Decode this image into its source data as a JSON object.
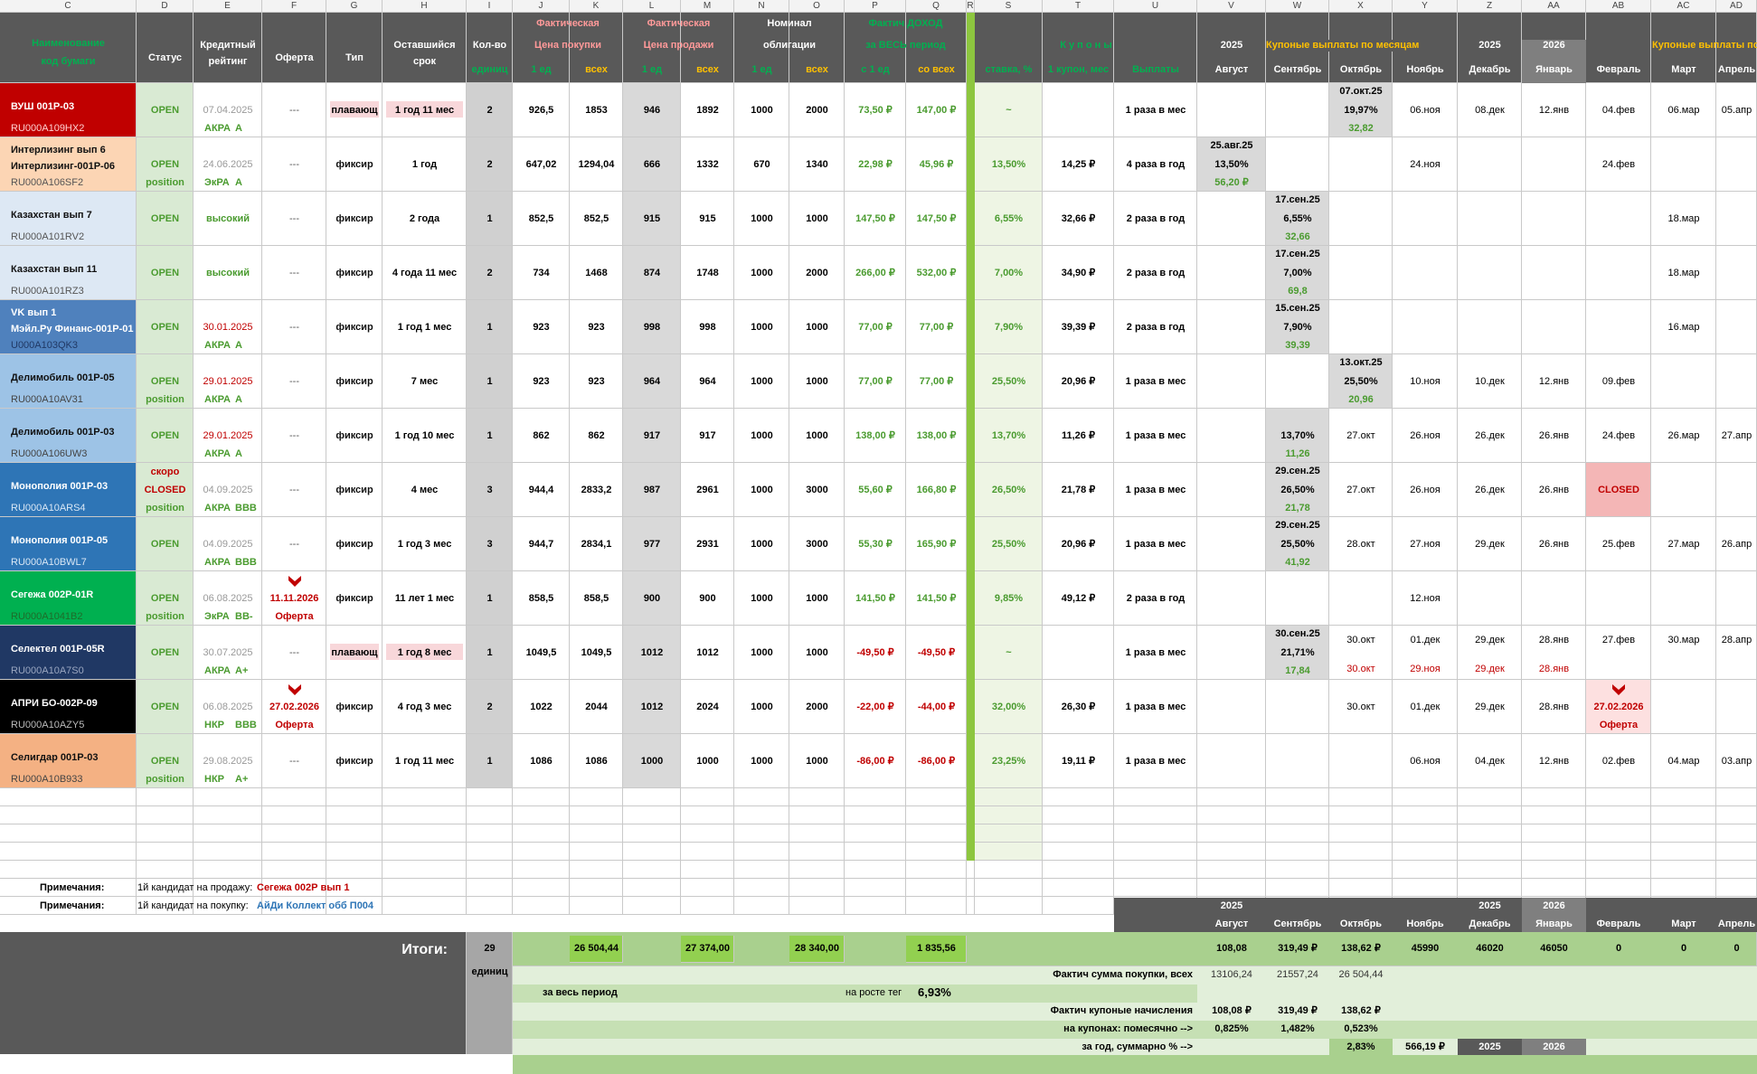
{
  "column_letters": [
    "C",
    "D",
    "E",
    "F",
    "G",
    "H",
    "I",
    "J",
    "K",
    "L",
    "M",
    "N",
    "O",
    "P",
    "Q",
    "R",
    "S",
    "T",
    "U",
    "V",
    "W",
    "X",
    "Y",
    "Z",
    "AA",
    "AB",
    "AC",
    "AD"
  ],
  "header": {
    "name_1": "Наименование",
    "name_2": "код бумаги",
    "status": "Статус",
    "rating_1": "Кредитный",
    "rating_2": "рейтинг",
    "offer": "Оферта",
    "type": "Тип",
    "term_1": "Оставшийся",
    "term_2": "срок",
    "qty_1": "Кол-во",
    "qty_2": "единиц",
    "buy_1": "Фактическая",
    "buy_2": "Цена  покупки",
    "sell_1": "Фактическая",
    "sell_2": "Цена  продажи",
    "nom_1": "Номинал",
    "nom_2": "облигации",
    "inc_1": "Фактич ДОХОД",
    "inc_2": "за ВЕСЬ период",
    "coupons": "К у п о н ы",
    "one_unit": "1 ед",
    "all": "всех",
    "from_one": "с 1 ед",
    "from_all": "со всех",
    "rate": "ставка, %",
    "one_coupon": "1 купон, мес",
    "payouts": "Выплаты",
    "year_2025a": "2025",
    "monthly_title": "Купоные выплаты по месяцам",
    "year_2025b": "2025",
    "year_2026": "2026",
    "monthly_title_2": "Купоные выплаты по месяцам",
    "months": [
      "Август",
      "Сентябрь",
      "Октябрь",
      "Ноябрь",
      "Декабрь",
      "Январь",
      "Февраль",
      "Март",
      "Апрель"
    ]
  },
  "rows": [
    {
      "name": "ВУШ 001P-03",
      "code": "RU000A109HX2",
      "status": "OPEN",
      "status2": "",
      "date": "07.04.2025",
      "agency": "АКРА",
      "grade": "А",
      "offer": "---",
      "type": "плавающ",
      "term": "1 год 11 мес",
      "qty": "2",
      "buy1": "926,5",
      "buyall": "1853",
      "sell1": "946",
      "sellall": "1892",
      "nom1": "1000",
      "nomall": "2000",
      "inc1": "73,50 ₽",
      "incall": "147,00 ₽",
      "rate": "~",
      "coupon": "",
      "payout": "1 раза в мес",
      "months": [
        "",
        "",
        "",
        "06.ноя",
        "08.дек",
        "12.янв",
        "04.фев",
        "06.мар",
        "05.апр"
      ],
      "box": {
        "col": 2,
        "date": "07.окт.25",
        "pct": "19,97%",
        "amt": "32,82"
      }
    },
    {
      "name": "Интерлизинг вып 6",
      "name2": "Интерлизинг-001P-06",
      "code": "RU000A106SF2",
      "status": "OPEN",
      "status2": "position",
      "date": "24.06.2025",
      "agency": "ЭкРА",
      "grade": "А",
      "offer": "---",
      "type": "фиксир",
      "term": "1 год",
      "qty": "2",
      "buy1": "647,02",
      "buyall": "1294,04",
      "sell1": "666",
      "sellall": "1332",
      "nom1": "670",
      "nomall": "1340",
      "inc1": "22,98 ₽",
      "incall": "45,96 ₽",
      "rate": "13,50%",
      "coupon": "14,25 ₽",
      "payout": "4 раза в год",
      "months": [
        "",
        "",
        "",
        "24.ноя",
        "",
        "",
        "24.фев",
        "",
        ""
      ],
      "box": {
        "col": 0,
        "date": "25.авг.25",
        "pct": "13,50%",
        "amt": "56,20 ₽"
      }
    },
    {
      "name": "Казахстан вып 7",
      "code": "RU000A101RV2",
      "status": "OPEN",
      "status2": "",
      "date": "высокий",
      "agency": "",
      "grade": "",
      "offer": "---",
      "type": "фиксир",
      "term": "2 года",
      "qty": "1",
      "buy1": "852,5",
      "buyall": "852,5",
      "sell1": "915",
      "sellall": "915",
      "nom1": "1000",
      "nomall": "1000",
      "inc1": "147,50 ₽",
      "incall": "147,50 ₽",
      "rate": "6,55%",
      "coupon": "32,66 ₽",
      "payout": "2 раза в год",
      "months": [
        "",
        "",
        "",
        "",
        "",
        "",
        "",
        "18.мар",
        ""
      ],
      "box": {
        "col": 1,
        "date": "17.сен.25",
        "pct": "6,55%",
        "amt": "32,66"
      }
    },
    {
      "name": "Казахстан вып 11",
      "code": "RU000A101RZ3",
      "status": "OPEN",
      "status2": "",
      "date": "высокий",
      "agency": "",
      "grade": "",
      "offer": "---",
      "type": "фиксир",
      "term": "4 года  11 мес",
      "qty": "2",
      "buy1": "734",
      "buyall": "1468",
      "sell1": "874",
      "sellall": "1748",
      "nom1": "1000",
      "nomall": "2000",
      "inc1": "266,00 ₽",
      "incall": "532,00 ₽",
      "rate": "7,00%",
      "coupon": "34,90 ₽",
      "payout": "2 раза в год",
      "months": [
        "",
        "",
        "",
        "",
        "",
        "",
        "",
        "18.мар",
        ""
      ],
      "box": {
        "col": 1,
        "date": "17.сен.25",
        "pct": "7,00%",
        "amt": "69,8"
      }
    },
    {
      "name": "VK вып 1",
      "name2": "Мэйл.Ру Финанс-001P-01",
      "code": "U000A103QK3",
      "status": "OPEN",
      "status2": "",
      "date": "30.01.2025",
      "agency": "АКРА",
      "grade": "А",
      "offer": "---",
      "type": "фиксир",
      "term": "1 год 1 мес",
      "qty": "1",
      "buy1": "923",
      "buyall": "923",
      "sell1": "998",
      "sellall": "998",
      "nom1": "1000",
      "nomall": "1000",
      "inc1": "77,00 ₽",
      "incall": "77,00 ₽",
      "rate": "7,90%",
      "coupon": "39,39 ₽",
      "payout": "2 раза в год",
      "months": [
        "",
        "",
        "",
        "",
        "",
        "",
        "",
        "16.мар",
        ""
      ],
      "box": {
        "col": 1,
        "date": "15.сен.25",
        "pct": "7,90%",
        "amt": "39,39"
      }
    },
    {
      "name": "Делимобиль 001P-05",
      "code": "RU000A10AV31",
      "status": "OPEN",
      "status2": "position",
      "date": "29.01.2025",
      "agency": "АКРА",
      "grade": "А",
      "offer": "---",
      "type": "фиксир",
      "term": "7 мес",
      "qty": "1",
      "buy1": "923",
      "buyall": "923",
      "sell1": "964",
      "sellall": "964",
      "nom1": "1000",
      "nomall": "1000",
      "inc1": "77,00 ₽",
      "incall": "77,00 ₽",
      "rate": "25,50%",
      "coupon": "20,96 ₽",
      "payout": "1 раза в мес",
      "months": [
        "",
        "",
        "",
        "10.ноя",
        "10.дек",
        "12.янв",
        "09.фев",
        "",
        ""
      ],
      "box": {
        "col": 2,
        "date": "13.окт.25",
        "pct": "25,50%",
        "amt": "20,96"
      }
    },
    {
      "name": "Делимобиль 001P-03",
      "code": "RU000A106UW3",
      "status": "OPEN",
      "status2": "",
      "date": "29.01.2025",
      "agency": "АКРА",
      "grade": "А",
      "offer": "---",
      "type": "фиксир",
      "term": "1 год 10 мес",
      "qty": "1",
      "buy1": "862",
      "buyall": "862",
      "sell1": "917",
      "sellall": "917",
      "nom1": "1000",
      "nomall": "1000",
      "inc1": "138,00 ₽",
      "incall": "138,00 ₽",
      "rate": "13,70%",
      "coupon": "11,26 ₽",
      "payout": "1 раза в мес",
      "months": [
        "",
        "",
        "27.окт",
        "26.ноя",
        "26.дек",
        "26.янв",
        "24.фев",
        "26.мар",
        "27.апр"
      ],
      "box": {
        "col": 1,
        "date": "",
        "pct": "13,70%",
        "amt": "11,26"
      }
    },
    {
      "name": "Монополия 001P-03",
      "code": "RU000A10ARS4",
      "status": "скоро",
      "status2": "CLOSED",
      "status3": "position",
      "date": "04.09.2025",
      "agency": "АКРА",
      "grade": "BBB",
      "offer": "---",
      "type": "фиксир",
      "term": "4 мес",
      "qty": "3",
      "buy1": "944,4",
      "buyall": "2833,2",
      "sell1": "987",
      "sellall": "2961",
      "nom1": "1000",
      "nomall": "3000",
      "inc1": "55,60 ₽",
      "incall": "166,80 ₽",
      "rate": "26,50%",
      "coupon": "21,78 ₽",
      "payout": "1 раза в мес",
      "months": [
        "",
        "",
        "27.окт",
        "26.ноя",
        "26.дек",
        "26.янв",
        "CLOSED",
        "",
        ""
      ],
      "box": {
        "col": 1,
        "date": "29.сен.25",
        "pct": "26,50%",
        "amt": "21,78"
      }
    },
    {
      "name": "Монополия 001P-05",
      "code": "RU000A10BWL7",
      "status": "OPEN",
      "status2": "",
      "date": "04.09.2025",
      "agency": "АКРА",
      "grade": "BBB",
      "offer": "---",
      "type": "фиксир",
      "term": "1 год 3 мес",
      "qty": "3",
      "buy1": "944,7",
      "buyall": "2834,1",
      "sell1": "977",
      "sellall": "2931",
      "nom1": "1000",
      "nomall": "3000",
      "inc1": "55,30 ₽",
      "incall": "165,90 ₽",
      "rate": "25,50%",
      "coupon": "20,96 ₽",
      "payout": "1 раза в мес",
      "months": [
        "",
        "",
        "28.окт",
        "27.ноя",
        "29.дек",
        "26.янв",
        "25.фев",
        "27.мар",
        "26.апр"
      ],
      "box": {
        "col": 1,
        "date": "29.сен.25",
        "pct": "25,50%",
        "amt": "41,92"
      }
    },
    {
      "name": "Сегежа 002P-01R",
      "code": "RU000A1041B2",
      "status": "OPEN",
      "status2": "position",
      "date": "06.08.2025",
      "agency": "ЭкРА",
      "grade": "BB-",
      "offer": "11.11.2026",
      "offer2": "Оферта",
      "type": "фиксир",
      "term": "11 лет  1 мес",
      "qty": "1",
      "buy1": "858,5",
      "buyall": "858,5",
      "sell1": "900",
      "sellall": "900",
      "nom1": "1000",
      "nomall": "1000",
      "inc1": "141,50 ₽",
      "incall": "141,50 ₽",
      "rate": "9,85%",
      "coupon": "49,12 ₽",
      "payout": "2 раза в год",
      "months": [
        "",
        "",
        "",
        "12.ноя",
        "",
        "",
        "",
        "",
        ""
      ],
      "box": null
    },
    {
      "name": "Селектел 001P-05R",
      "code": "RU000A10A7S0",
      "status": "OPEN",
      "status2": "",
      "date": "30.07.2025",
      "agency": "АКРА",
      "grade": "А+",
      "offer": "---",
      "type": "плавающ",
      "term": "1 год 8 мес",
      "qty": "1",
      "buy1": "1049,5",
      "buyall": "1049,5",
      "sell1": "1012",
      "sellall": "1012",
      "nom1": "1000",
      "nomall": "1000",
      "inc1": "-49,50 ₽",
      "incall": "-49,50 ₽",
      "rate": "~",
      "coupon": "",
      "payout": "1 раза в мес",
      "months": [
        "",
        "",
        "30.окт",
        "01.дек",
        "29.дек",
        "28.янв",
        "27.фев",
        "30.мар",
        "28.апр"
      ],
      "months_red": [
        "",
        "",
        "30.окт",
        "29.ноя",
        "29.дек",
        "28.янв",
        "",
        "",
        ""
      ],
      "box": {
        "col": 1,
        "date": "30.сен.25",
        "pct": "21,71%",
        "amt": "17,84"
      }
    },
    {
      "name": "АПРИ БО-002P-09",
      "code": "RU000A10AZY5",
      "status": "OPEN",
      "status2": "",
      "date": "06.08.2025",
      "agency": "НКР",
      "grade": "BBB",
      "offer": "27.02.2026",
      "offer2": "Оферта",
      "type": "фиксир",
      "term": "4 год 3 мес",
      "qty": "2",
      "buy1": "1022",
      "buyall": "2044",
      "sell1": "1012",
      "sellall": "2024",
      "nom1": "1000",
      "nomall": "2000",
      "inc1": "-22,00 ₽",
      "incall": "-44,00 ₽",
      "rate": "32,00%",
      "coupon": "26,30 ₽",
      "payout": "1 раза в мес",
      "months": [
        "",
        "",
        "30.окт",
        "01.дек",
        "29.дек",
        "28.янв",
        "27.02.2026",
        "",
        ""
      ],
      "box": null,
      "feb_offer": "Оферта"
    },
    {
      "name": "Селигдар 001P-03",
      "code": "RU000A10B933",
      "status": "OPEN",
      "status2": "position",
      "date": "29.08.2025",
      "agency": "НКР",
      "grade": "А+",
      "offer": "---",
      "type": "фиксир",
      "term": "1 год 11 мес",
      "qty": "1",
      "buy1": "1086",
      "buyall": "1086",
      "sell1": "1000",
      "sellall": "1000",
      "nom1": "1000",
      "nomall": "1000",
      "inc1": "-86,00 ₽",
      "incall": "-86,00 ₽",
      "rate": "23,25%",
      "coupon": "19,11 ₽",
      "payout": "1 раза в мес",
      "months": [
        "",
        "",
        "",
        "06.ноя",
        "04.дек",
        "12.янв",
        "02.фев",
        "04.мар",
        "03.апр"
      ],
      "box": null
    }
  ],
  "notes": {
    "label": "Примечания:",
    "sell_prefix": "1й кандидат на продажу:",
    "sell_value": "Сегежа 002Р вып 1",
    "buy_prefix": "1й кандидат на покупку:",
    "buy_value": "АйДи Коллект обб П004"
  },
  "totals": {
    "label": "Итоги:",
    "qty": "29",
    "qty_unit": "единиц",
    "buy_all": "26 504,44",
    "sell_all": "27 374,00",
    "nom_all": "28 340,00",
    "inc_all": "1 835,56",
    "period_label": "за весь период",
    "growth_label": "на росте тег",
    "growth_value": "6,93%",
    "years": [
      "2025",
      "2025",
      "2026"
    ],
    "months": [
      "Август",
      "Сентябрь",
      "Октябрь",
      "Ноябрь",
      "Декабрь",
      "Январь",
      "Февраль",
      "Март",
      "Апрель"
    ],
    "month_values": [
      "108,08",
      "319,49 ₽",
      "138,62 ₽",
      "45990",
      "46020",
      "46050",
      "0",
      "0",
      "0"
    ],
    "purchase_label": "Фактич сумма покупки, всех",
    "purchase_values": [
      "13106,24",
      "21557,24",
      "26 504,44"
    ],
    "accrual_label": "Фактич купоные начисления",
    "accrual_values": [
      "108,08 ₽",
      "319,49 ₽",
      "138,62 ₽"
    ],
    "coupon_label": "на купонах:   помесячно -->",
    "coupon_values": [
      "0,825%",
      "1,482%",
      "0,523%"
    ],
    "year_label": "за год, суммарно  % -->",
    "year_values": [
      "2,83%",
      "566,19 ₽"
    ],
    "year_tags": [
      "2025",
      "2026"
    ]
  },
  "colors": {
    "header_bg": "#595959",
    "green_accent": "#00b050",
    "pink_text": "#ff9999",
    "yellow_text": "#ffc000",
    "open_bg": "#d9ead3",
    "qty_bg": "#d0d0d0",
    "rate_bg": "#eef5e4",
    "divider_green": "#8dc63f",
    "totals_green": "#a9d08e",
    "closed_bg": "#f4b6b6"
  }
}
